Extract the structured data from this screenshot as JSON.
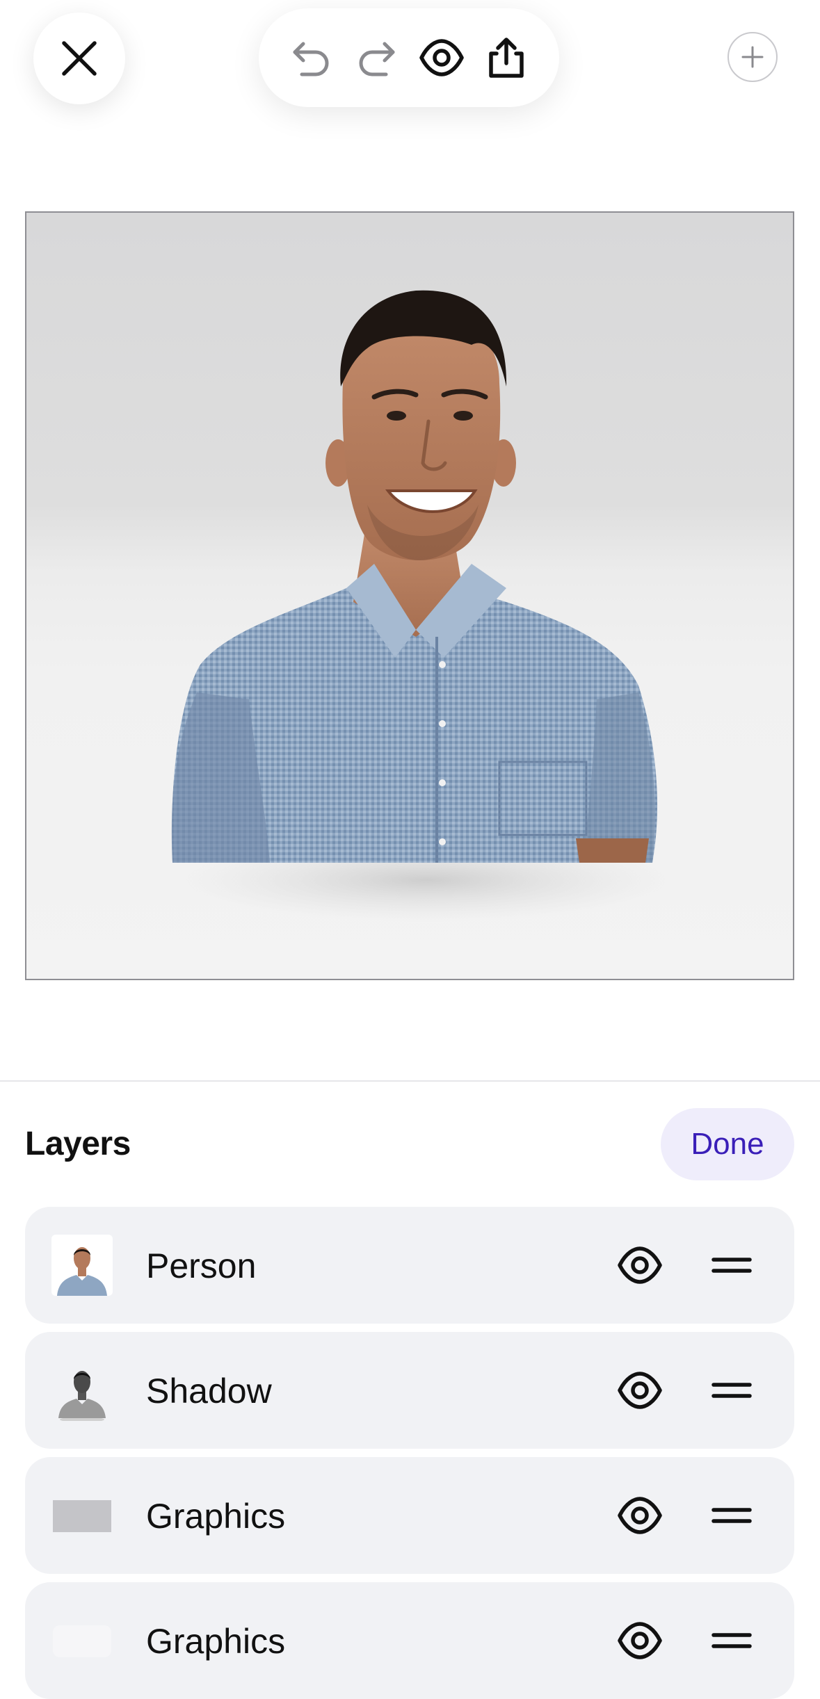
{
  "toolbar": {
    "close_icon": "close-icon",
    "undo_icon": "undo-icon",
    "redo_icon": "redo-icon",
    "preview_icon": "eye-icon",
    "share_icon": "share-icon",
    "add_icon": "plus-icon"
  },
  "canvas": {
    "content": "portrait-photo"
  },
  "layers_panel": {
    "title": "Layers",
    "done_label": "Done",
    "accent_color": "#3a1fb8",
    "items": [
      {
        "label": "Person",
        "thumbnail": "person-thumbnail",
        "visibility_icon": "eye-icon",
        "handle_icon": "drag-handle-icon"
      },
      {
        "label": "Shadow",
        "thumbnail": "shadow-thumbnail",
        "visibility_icon": "eye-icon",
        "handle_icon": "drag-handle-icon"
      },
      {
        "label": "Graphics",
        "thumbnail": "gray-rectangle-thumbnail",
        "visibility_icon": "eye-icon",
        "handle_icon": "drag-handle-icon"
      },
      {
        "label": "Graphics",
        "thumbnail": "light-rectangle-thumbnail",
        "visibility_icon": "eye-icon",
        "handle_icon": "drag-handle-icon"
      }
    ]
  }
}
